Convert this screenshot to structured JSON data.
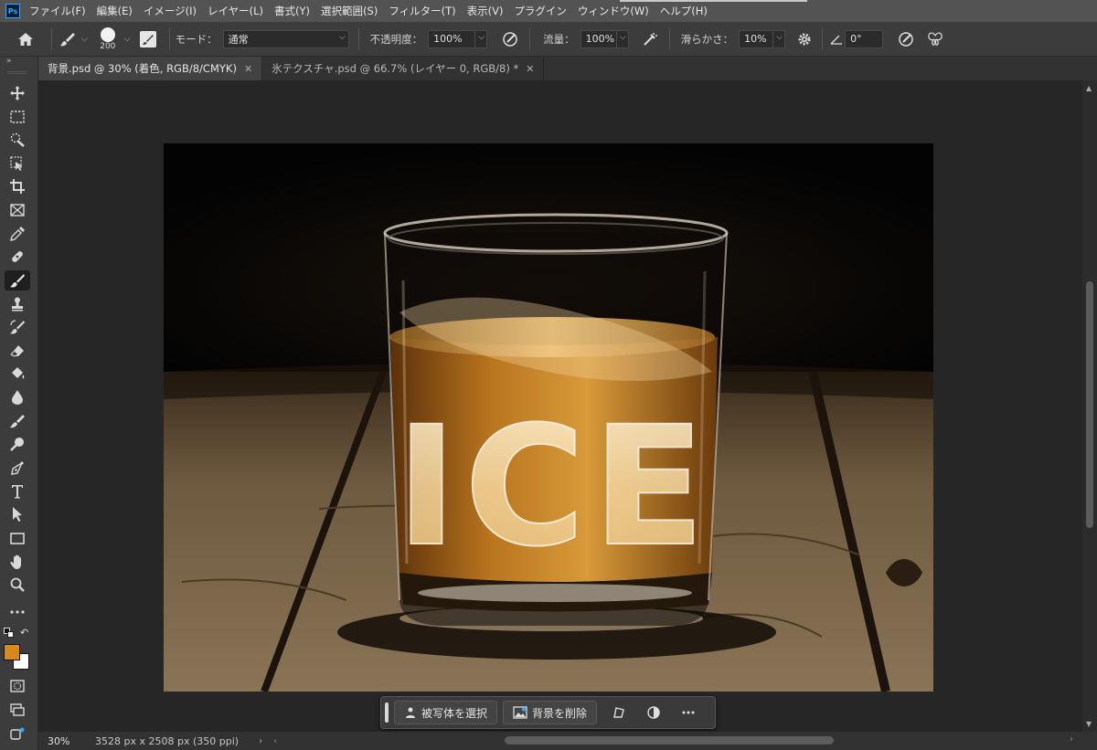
{
  "app": {
    "logo": "Ps"
  },
  "menu": [
    "ファイル(F)",
    "編集(E)",
    "イメージ(I)",
    "レイヤー(L)",
    "書式(Y)",
    "選択範囲(S)",
    "フィルター(T)",
    "表示(V)",
    "プラグイン",
    "ウィンドウ(W)",
    "ヘルプ(H)"
  ],
  "options": {
    "brush_size": "200",
    "mode_label": "モード：",
    "mode_value": "通常",
    "opacity_label": "不透明度：",
    "opacity_value": "100%",
    "flow_label": "流量：",
    "flow_value": "100%",
    "smoothing_label": "滑らかさ：",
    "smoothing_value": "10%",
    "angle_value": "0°"
  },
  "tabs": [
    {
      "label": "背景.psd @ 30% (着色, RGB/8/CMYK)",
      "active": true
    },
    {
      "label": "氷テクスチャ.psd @ 66.7% (レイヤー 0, RGB/8) *",
      "active": false
    }
  ],
  "image": {
    "text": "ICE"
  },
  "context_bar": {
    "select_subject": "被写体を選択",
    "remove_bg": "背景を削除"
  },
  "status": {
    "zoom": "30%",
    "doc_info": "3528 px x 2508 px (350 ppi)"
  },
  "colors": {
    "foreground": "#d68a1e",
    "background": "#ffffff",
    "accent": "#31a8ff"
  },
  "toolbar_icons": [
    "move-icon",
    "marquee-icon",
    "quick-select-icon",
    "object-select-icon",
    "crop-icon",
    "frame-icon",
    "eyedropper-icon",
    "healing-icon",
    "brush-icon",
    "stamp-icon",
    "history-brush-icon",
    "eraser-icon",
    "paint-bucket-icon",
    "blur-icon",
    "smudge-icon",
    "dodge-icon",
    "pen-icon",
    "type-icon",
    "path-select-icon",
    "rectangle-icon",
    "hand-icon",
    "zoom-icon",
    "more-icon"
  ]
}
